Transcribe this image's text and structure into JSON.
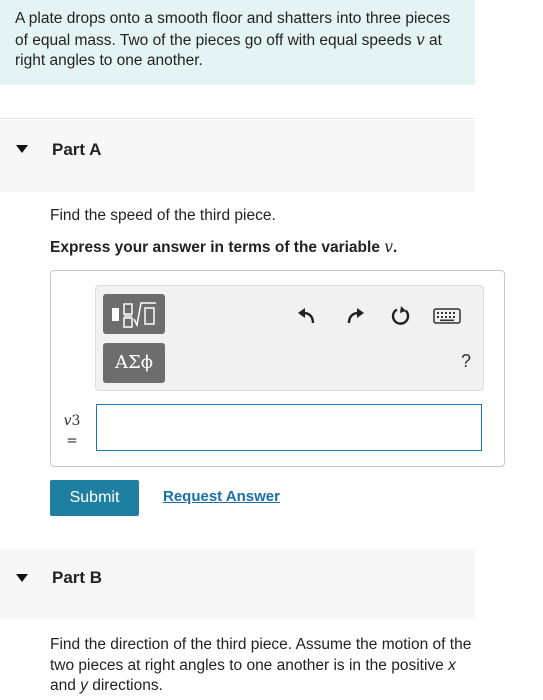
{
  "intro": {
    "text_before": "A plate drops onto a smooth floor and shatters into three pieces of equal mass. Two of the pieces go off with equal speeds ",
    "var": "v",
    "text_after": " at right angles to one another."
  },
  "part_a": {
    "title": "Part A",
    "question": "Find the speed of the third piece.",
    "express_before": "Express your answer in terms of the variable ",
    "express_var": "v",
    "express_after": ".",
    "toolbar": {
      "greek_button_label": "ΑΣϕ",
      "help_label": "?",
      "icons": [
        "templates-icon",
        "undo-icon",
        "redo-icon",
        "reset-icon",
        "keyboard-icon",
        "help-icon"
      ]
    },
    "answer_var": "v",
    "answer_subscript": "3",
    "answer_equals": "=",
    "answer_value": "",
    "submit_label": "Submit",
    "request_label": "Request Answer"
  },
  "part_b": {
    "title": "Part B",
    "text_1": "Find the direction of the third piece. Assume the motion of the two pieces at right angles to one another is in the positive ",
    "x_var": "x",
    "text_2": " and ",
    "y_var": "y",
    "text_3": " directions."
  },
  "colors": {
    "intro_bg": "#e4f3f3",
    "submit_bg": "#1f7fa1",
    "link": "#1a6fa6",
    "input_border": "#1a7ab8"
  }
}
